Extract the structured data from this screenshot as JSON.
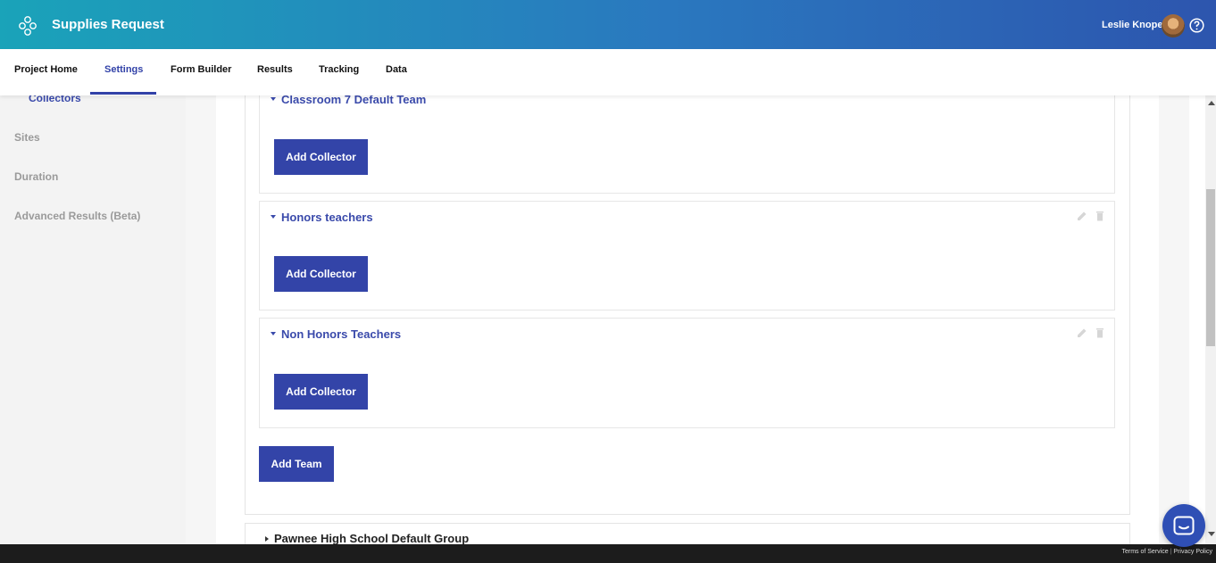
{
  "header": {
    "app_title": "Supplies Request",
    "user_name": "Leslie Knope",
    "gradient_start": "#1aa3b9",
    "gradient_end": "#2d55ae"
  },
  "nav": {
    "tabs": [
      {
        "label": "Project Home"
      },
      {
        "label": "Settings",
        "active": true
      },
      {
        "label": "Form Builder"
      },
      {
        "label": "Results"
      },
      {
        "label": "Tracking"
      },
      {
        "label": "Data"
      }
    ]
  },
  "sidebar": {
    "items": [
      {
        "label": "Collectors",
        "active": true
      },
      {
        "label": "Sites"
      },
      {
        "label": "Duration"
      },
      {
        "label": "Advanced Results (Beta)"
      }
    ]
  },
  "groups": [
    {
      "teams": [
        {
          "name": "Classroom 7 Default Team",
          "button": "Add Collector"
        },
        {
          "name": "Honors teachers",
          "button": "Add Collector"
        },
        {
          "name": "Non Honors Teachers",
          "button": "Add Collector"
        }
      ],
      "add_team_label": "Add Team"
    },
    {
      "name": "Pawnee High School Default Group"
    }
  ],
  "footer": {
    "terms": "Terms of Service",
    "separator": "|",
    "privacy": "Privacy Policy"
  },
  "colors": {
    "accent": "#3344a8",
    "link": "#3a4aab"
  }
}
